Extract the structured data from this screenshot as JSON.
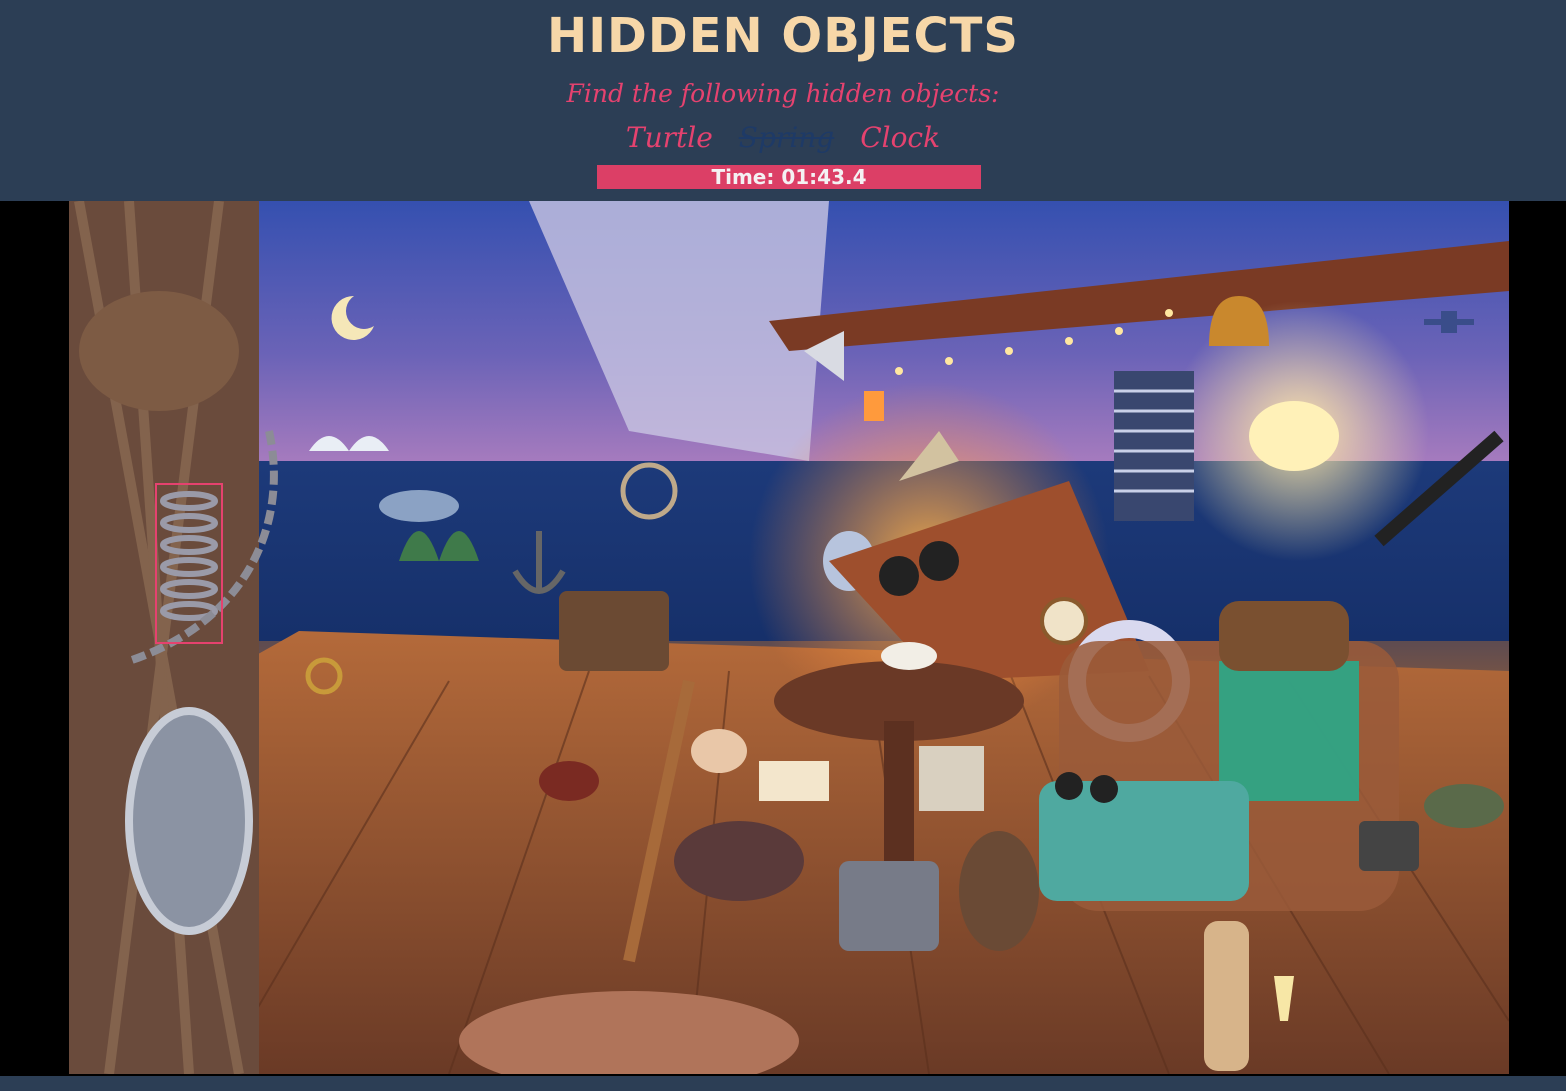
{
  "header": {
    "title": "HIDDEN OBJECTS",
    "instructions": "Find the following hidden objects:",
    "objects": [
      {
        "label": "Turtle",
        "found": false
      },
      {
        "label": "Spring",
        "found": true
      },
      {
        "label": "Clock",
        "found": false
      }
    ],
    "timer": "Time: 01:43.4"
  },
  "colors": {
    "background": "#2c3e55",
    "title": "#f7d7a8",
    "accent": "#e5426f",
    "found_text": "#1e3a66",
    "timer_bg": "#dc3f66"
  },
  "scene": {
    "objects": [
      "rope-knot",
      "spring",
      "chain",
      "seagull",
      "moon",
      "hot-air-balloon",
      "volcano",
      "whale",
      "anchor",
      "ship-wheel",
      "lantern",
      "megaphone",
      "bell",
      "gramophone",
      "guitar",
      "vinyl-records",
      "striped-top",
      "floodlight",
      "telescope",
      "biplane",
      "suitcase",
      "umbrella",
      "shoes",
      "clock",
      "map",
      "round-table",
      "teacup",
      "ice-bucket",
      "stool",
      "dog",
      "lifebuoy",
      "armchair",
      "sunglasses",
      "camera",
      "turtle",
      "wine-bottle",
      "champagne-glass",
      "keys",
      "oar",
      "lobster",
      "seashell",
      "diving-helmet",
      "carabiner",
      "barrel",
      "chess-board",
      "book",
      "plant",
      "porthole"
    ]
  }
}
